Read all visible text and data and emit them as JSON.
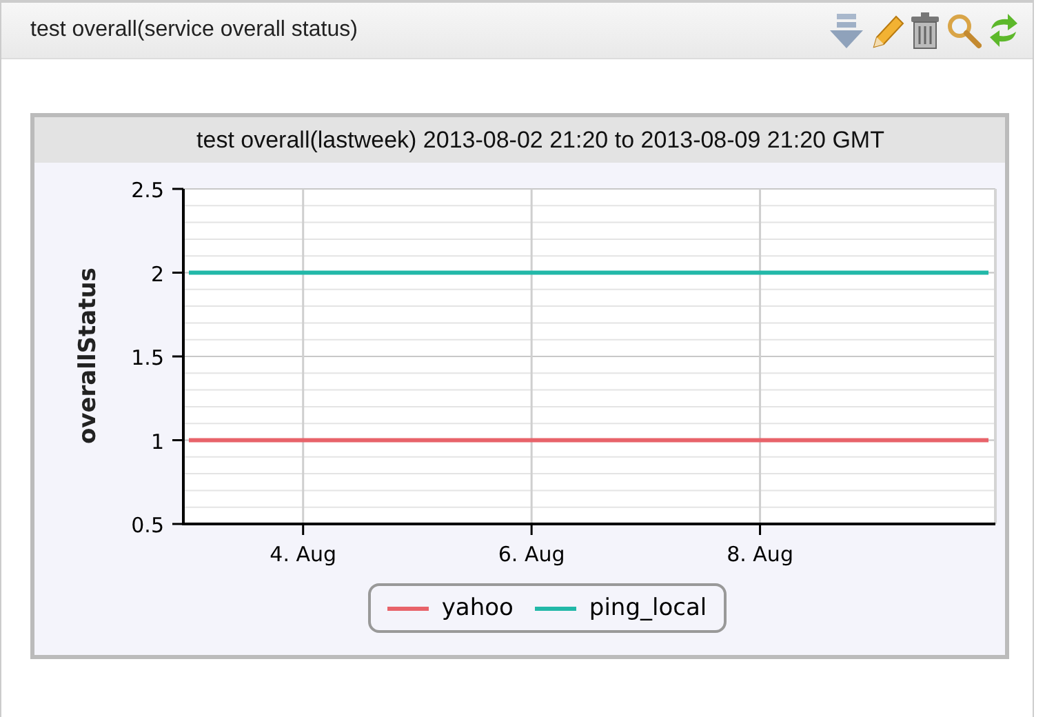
{
  "panel": {
    "title": "test overall(service overall status)"
  },
  "chart": {
    "title": "test overall(lastweek) 2013-08-02 21:20 to 2013-08-09 21:20 GMT",
    "chart_data": {
      "type": "line",
      "ylabel": "overallStatus",
      "categories": [
        null,
        "4. Aug",
        null,
        "6. Aug",
        null,
        "8. Aug",
        null,
        null
      ],
      "series": [
        {
          "name": "yahoo",
          "color": "#e8636a",
          "values": [
            1,
            1,
            1,
            1,
            1,
            1,
            1,
            1
          ]
        },
        {
          "name": "ping_local",
          "color": "#22b8a8",
          "values": [
            2,
            2,
            2,
            2,
            2,
            2,
            2,
            2
          ]
        }
      ],
      "ylim": [
        0.5,
        2.5
      ],
      "grid": true,
      "legend": "bottom",
      "yticks": [
        0.5,
        1,
        1.5,
        2,
        2.5
      ]
    }
  }
}
